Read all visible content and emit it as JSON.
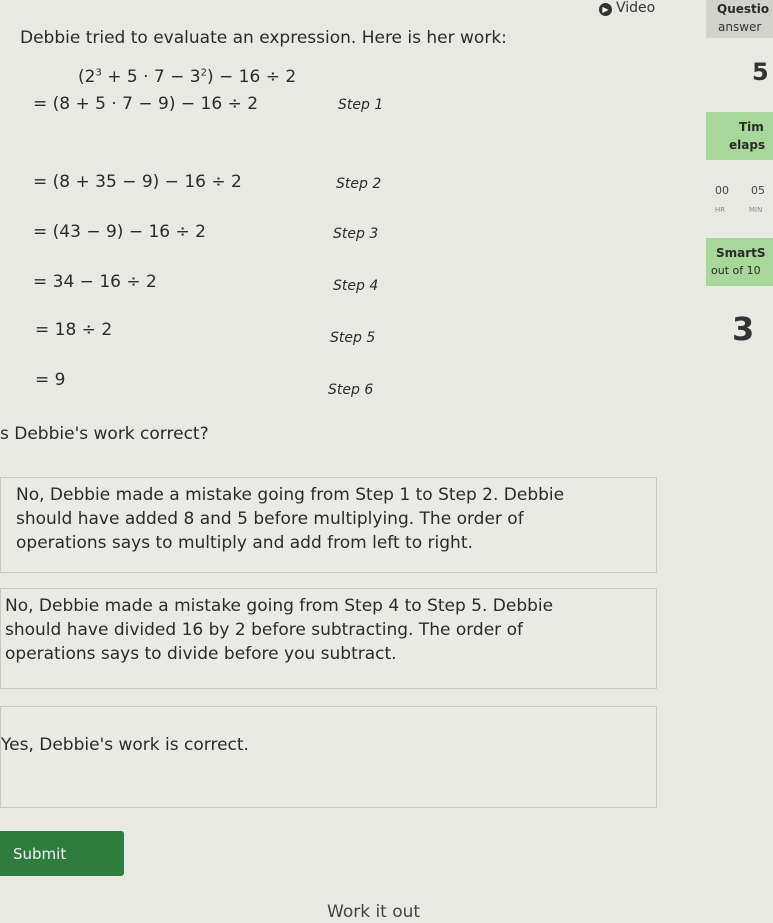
{
  "intro": "Debbie tried to evaluate an expression. Here is her work:",
  "expression": {
    "base_num": "2",
    "exp1": "3",
    "middle": " + 5 · 7 − 3",
    "exp2": "2",
    "tail": " − 16 ÷ 2"
  },
  "steps": [
    {
      "expr": "= (8 + 5 · 7 − 9) − 16 ÷ 2",
      "label": "Step 1"
    },
    {
      "expr": "= (8 + 35 − 9) − 16 ÷ 2",
      "label": "Step 2"
    },
    {
      "expr": "= (43 − 9) − 16 ÷ 2",
      "label": "Step 3"
    },
    {
      "expr": "= 34 − 16 ÷ 2",
      "label": "Step 4"
    },
    {
      "expr": "= 18 ÷ 2",
      "label": "Step 5"
    },
    {
      "expr": "= 9",
      "label": "Step 6"
    }
  ],
  "question": "s Debbie's work correct?",
  "choices": [
    {
      "lines": [
        "No, Debbie made a mistake going from Step 1 to Step 2. Debbie",
        "should have added 8 and 5 before multiplying. The order of",
        "operations says to multiply and add from left to right."
      ]
    },
    {
      "lines": [
        "No, Debbie made a mistake going from Step 4 to Step 5. Debbie",
        "should have divided 16 by 2 before subtracting. The order of",
        "operations says to divide before you subtract."
      ]
    },
    {
      "lines": [
        "Yes, Debbie's work is correct."
      ]
    }
  ],
  "submit_label": "Submit",
  "work_it_out": "Work it out",
  "video": {
    "icon": "play-icon",
    "label": "Video"
  },
  "sidebar": {
    "questions_label": "Questio",
    "answered_label": "answer",
    "answered_count": "5",
    "time_label": "Tim",
    "elapsed_label": "elaps",
    "hours": "00",
    "minutes": "05",
    "hours_sub": "HR",
    "minutes_sub": "MIN",
    "smartscore_label": "SmartS",
    "out_of": "out of 10",
    "score": "3"
  },
  "colors": {
    "submit_green": "#2f7d3e",
    "panel_green": "#a8d79a",
    "background": "#e9e9e4"
  }
}
